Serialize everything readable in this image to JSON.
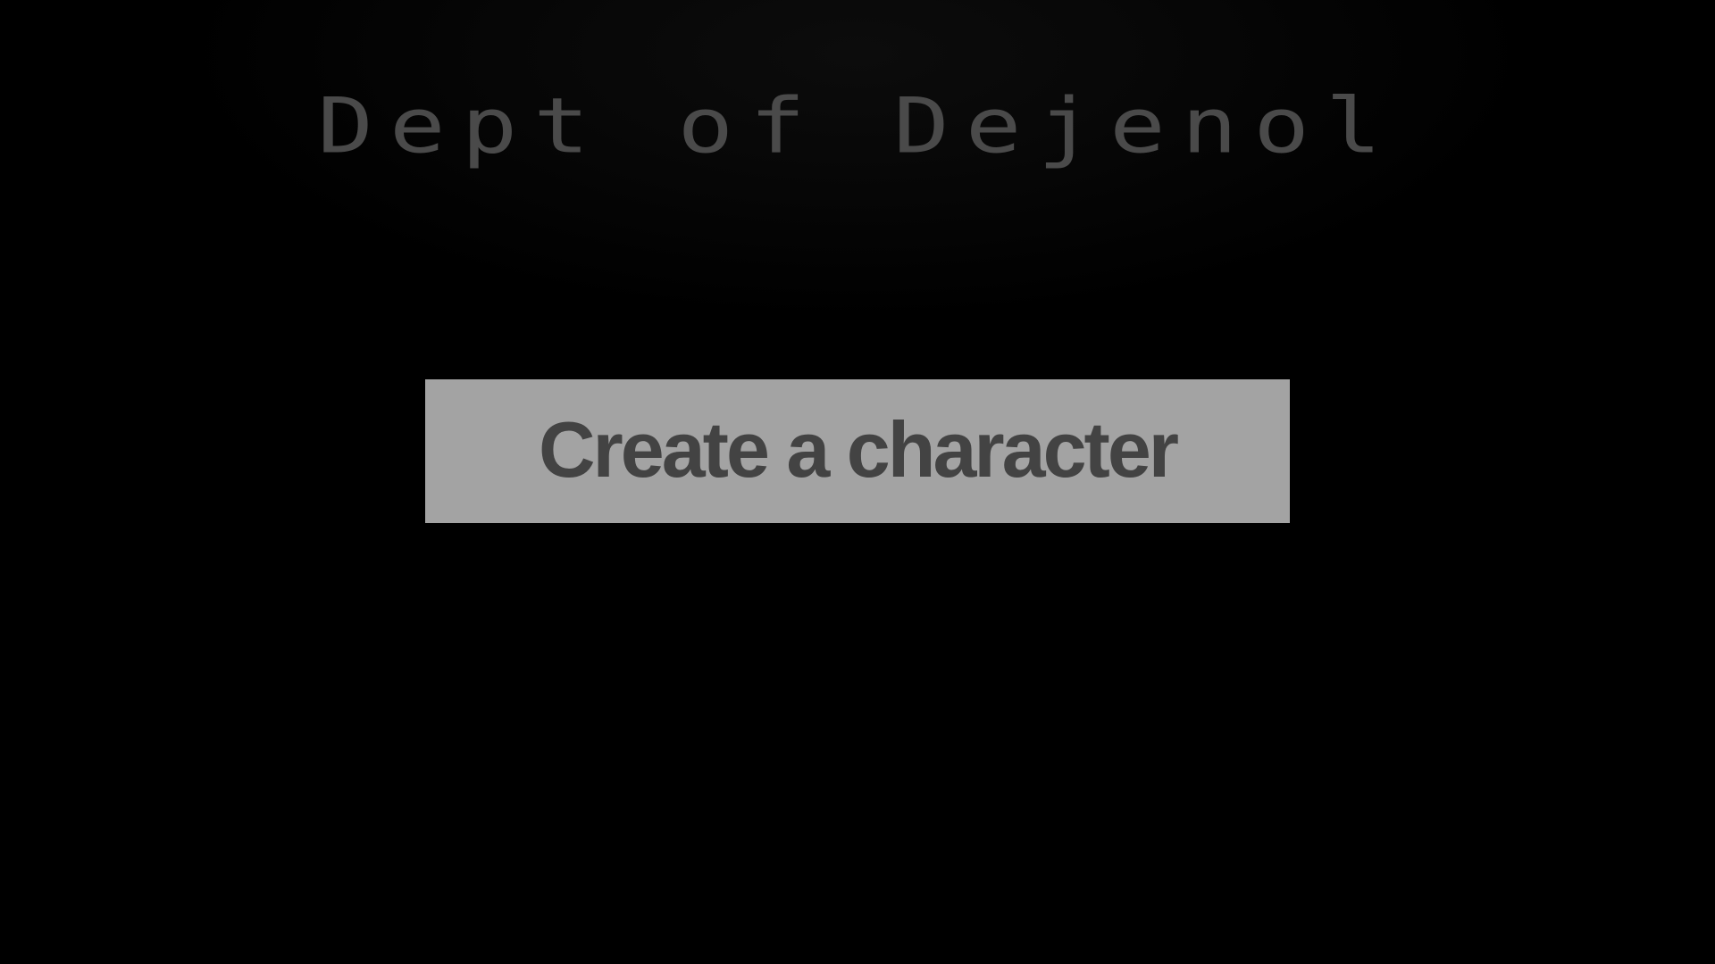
{
  "title_screen": {
    "game_title": "Dept of Dejenol",
    "create_button_label": "Create a character"
  },
  "colors": {
    "background": "#000000",
    "title_text": "#4a4a4a",
    "button_background": "#a3a3a3",
    "button_text": "#434343"
  }
}
